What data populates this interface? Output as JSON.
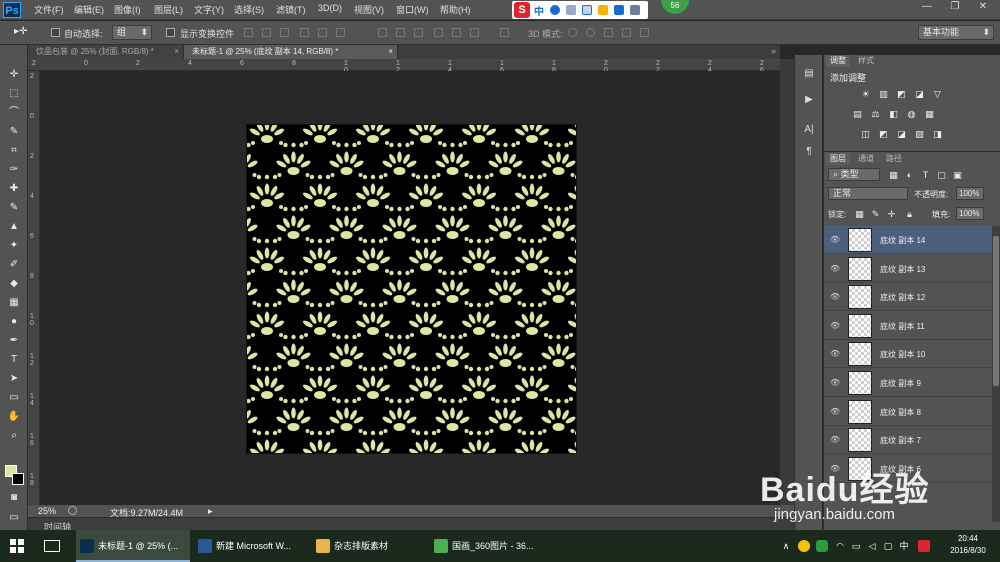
{
  "app": {
    "logo": "Ps"
  },
  "menu": [
    "文件(F)",
    "编辑(E)",
    "图像(I)",
    "图层(L)",
    "文字(Y)",
    "选择(S)",
    "滤镜(T)",
    "3D(D)",
    "视图(V)",
    "窗口(W)",
    "帮助(H)"
  ],
  "ime": {
    "logo": "S",
    "mode": "中"
  },
  "notif_badge": "56",
  "options": {
    "auto_select_label": "自动选择:",
    "auto_select_value": "组",
    "show_transform_label": "显示变换控件",
    "mode3d_label": "3D 模式:",
    "workspace": "基本功能"
  },
  "tabs": [
    {
      "label": "饮品包装 @ 25% (封面, RGB/8) *",
      "active": false
    },
    {
      "label": "未标题-1 @ 25% (底纹 副本 14, RGB/8) *",
      "active": true
    }
  ],
  "ruler_top": [
    "2",
    "0",
    "2",
    "4",
    "6",
    "8",
    "1\n0",
    "1\n2",
    "1\n4",
    "1\n6",
    "1\n8",
    "2\n0",
    "2\n2",
    "2\n4",
    "2\n6"
  ],
  "ruler_left": [
    "2",
    "0",
    "2",
    "4",
    "6",
    "8",
    "1\n0",
    "1\n2",
    "1\n4",
    "1\n6",
    "1\n8"
  ],
  "status": {
    "zoom": "25%",
    "doc": "文档:9.27M/24.4M"
  },
  "timeline_label": "时间轴",
  "panels": {
    "adjust_tab": "调整",
    "style_tab": "样式",
    "add_adjust": "添加调整",
    "layers_tab": "图层",
    "channels_tab": "通道",
    "paths_tab": "路径",
    "kind": "类型",
    "blend": "正常",
    "opacity_label": "不透明度:",
    "opacity_value": "100%",
    "lock_label": "锁定:",
    "fill_label": "填充:",
    "fill_value": "100%"
  },
  "layers": [
    {
      "name": "底纹 副本 14",
      "selected": true
    },
    {
      "name": "底纹 副本 13",
      "selected": false
    },
    {
      "name": "底纹 副本 12",
      "selected": false
    },
    {
      "name": "底纹 副本 11",
      "selected": false
    },
    {
      "name": "底纹 副本 10",
      "selected": false
    },
    {
      "name": "底纹 副本 9",
      "selected": false
    },
    {
      "name": "底纹 副本 8",
      "selected": false
    },
    {
      "name": "底纹 副本 7",
      "selected": false
    },
    {
      "name": "底纹 副本 6",
      "selected": false
    }
  ],
  "taskbar": {
    "items": [
      {
        "label": "未标题-1 @ 25% (...",
        "color": "#0a2f4c",
        "active": true
      },
      {
        "label": "新建 Microsoft W...",
        "color": "#2b5797",
        "active": false
      },
      {
        "label": "杂志排版素材",
        "color": "#e8b64a",
        "active": false
      },
      {
        "label": "国画_360图片 - 36...",
        "color": "#4caf50",
        "active": false
      }
    ],
    "time": "20:44",
    "date": "2016/8/30",
    "tray_lang": "中"
  },
  "watermark": {
    "brand": "Baidu经验",
    "url": "jingyan.baidu.com"
  },
  "colors": {
    "pattern": "#dde6a0",
    "selection": "#4c5f7c"
  }
}
